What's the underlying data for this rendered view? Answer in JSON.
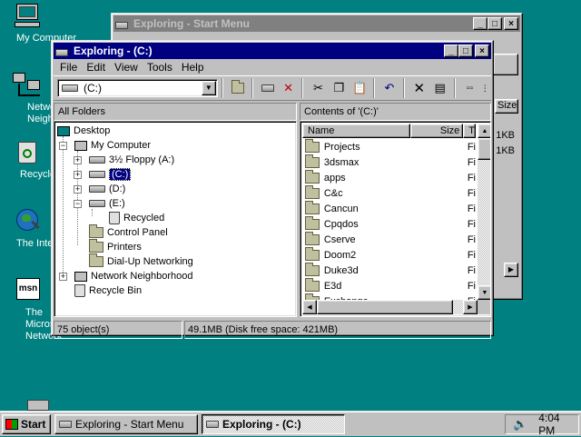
{
  "desktop": {
    "icons": [
      {
        "label": "My Computer"
      },
      {
        "label": "Network Neighborhood"
      },
      {
        "label": "Recycle Bin"
      },
      {
        "label": "The Internet"
      },
      {
        "label": "The Microsoft Network"
      }
    ]
  },
  "back_window": {
    "title": "Exploring - Start Menu",
    "sizes": [
      "Size",
      "1KB",
      "1KB"
    ]
  },
  "window": {
    "title": "Exploring - (C:)",
    "menu": [
      "File",
      "Edit",
      "View",
      "Tools",
      "Help"
    ],
    "address": "(C:)",
    "left_header": "All Folders",
    "right_header": "Contents of '(C:)'",
    "tree": [
      {
        "label": "Desktop",
        "icon": "desktop-icon"
      },
      {
        "label": "My Computer",
        "icon": "computer-icon"
      },
      {
        "label": "3½ Floppy (A:)",
        "icon": "floppy-drive-icon"
      },
      {
        "label": "(C:)",
        "icon": "hard-drive-icon"
      },
      {
        "label": "(D:)",
        "icon": "hard-drive-icon"
      },
      {
        "label": "(E:)",
        "icon": "hard-drive-icon"
      },
      {
        "label": "Recycled",
        "icon": "recycle-bin-icon"
      },
      {
        "label": "Control Panel",
        "icon": "control-panel-icon"
      },
      {
        "label": "Printers",
        "icon": "printers-icon"
      },
      {
        "label": "Dial-Up Networking",
        "icon": "dialup-icon"
      },
      {
        "label": "Network Neighborhood",
        "icon": "network-icon"
      },
      {
        "label": "Recycle Bin",
        "icon": "recycle-bin-icon"
      }
    ],
    "columns": {
      "name": "Name",
      "size": "Size",
      "type": "T"
    },
    "files": [
      {
        "name": "Projects",
        "type": "Fi"
      },
      {
        "name": "3dsmax",
        "type": "Fi"
      },
      {
        "name": "apps",
        "type": "Fi"
      },
      {
        "name": "C&c",
        "type": "Fi"
      },
      {
        "name": "Cancun",
        "type": "Fi"
      },
      {
        "name": "Cpqdos",
        "type": "Fi"
      },
      {
        "name": "Cserve",
        "type": "Fi"
      },
      {
        "name": "Doom2",
        "type": "Fi"
      },
      {
        "name": "Duke3d",
        "type": "Fi"
      },
      {
        "name": "E3d",
        "type": "Fi"
      },
      {
        "name": "Exchange",
        "type": "Fi"
      }
    ],
    "status": {
      "count": "75 object(s)",
      "size": "49.1MB (Disk free space: 421MB)"
    }
  },
  "taskbar": {
    "start": "Start",
    "tasks": [
      "Exploring - Start Menu",
      "Exploring - (C:)"
    ],
    "time": "4:04 PM"
  },
  "colors": {
    "desktop": "#008080",
    "active_title": "#000080",
    "inactive_title": "#808080",
    "face": "#c0c0c0"
  }
}
